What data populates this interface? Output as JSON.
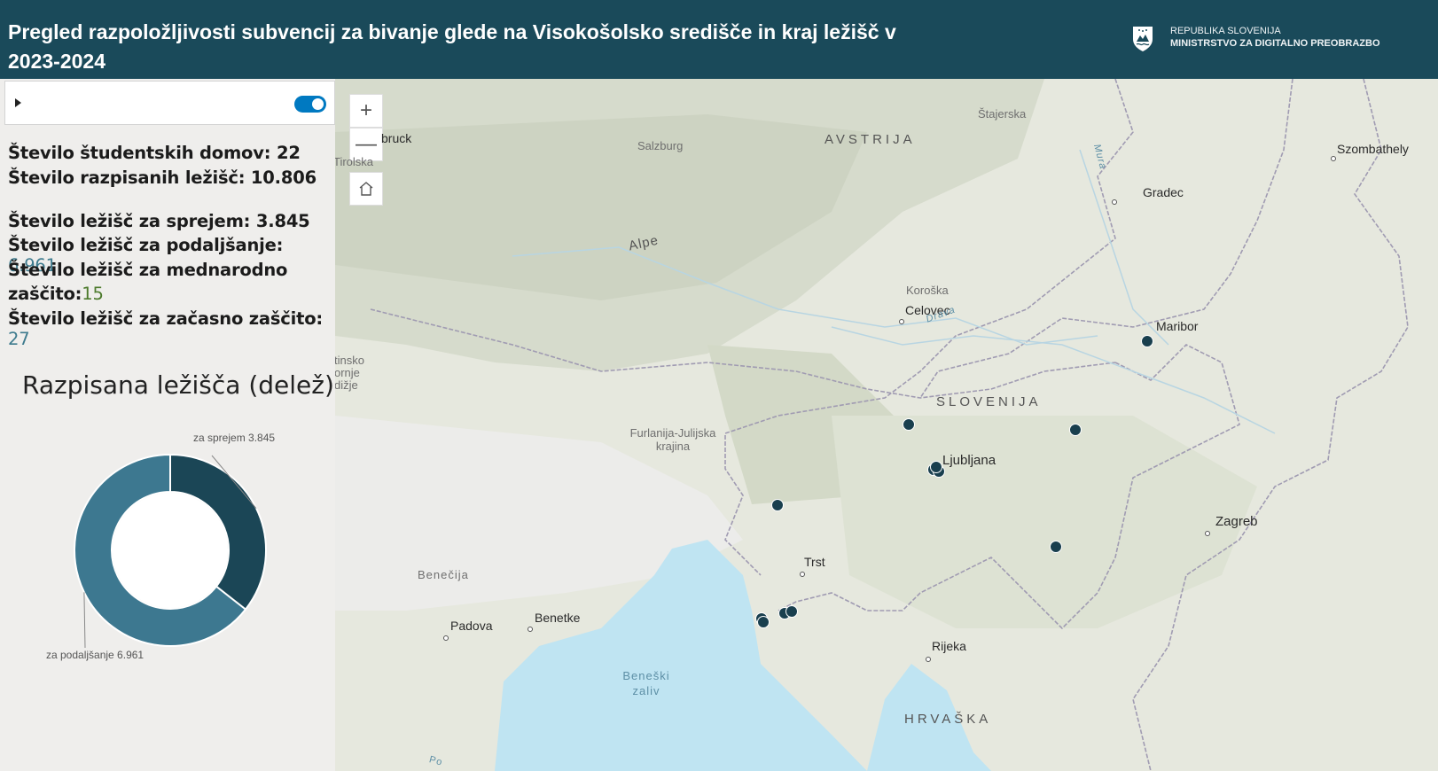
{
  "header": {
    "title": "Pregled razpoložljivosti subvencij za bivanje glede na Visokošolsko središče in kraj ležišč v 2023-2024",
    "logo_line1": "REPUBLIKA SLOVENIJA",
    "logo_line2": "MINISTRSTVO ZA DIGITALNO PREOBRAZBO"
  },
  "stats": {
    "domovi": "Število študentskih domov: 22",
    "razpisana": "Število razpisanih ležišč: 10.806",
    "sprejem": "Število ležišč za sprejem: 3.845",
    "podaljsanje_label": "Število ležišč za podaljšanje: ",
    "podaljsanje_value": "6.961",
    "mednarodno_line1": "Število ležišč za mednarodno",
    "mednarodno_line2": "zaščito:",
    "mednarodno_value": "15",
    "zacasno_label": "Število ležišč za začasno zaščito: ",
    "zacasno_value": "27"
  },
  "chart_data": {
    "type": "pie",
    "title": "Razpisana ležišča (delež)",
    "categories": [
      "za sprejem",
      "za podaljšanje"
    ],
    "values": [
      3845,
      6961
    ],
    "labels": [
      "za sprejem 3.845",
      "za podaljšanje 6.961"
    ],
    "colors": [
      "#1b4656",
      "#3d7890"
    ],
    "donut": true
  },
  "map": {
    "countries": [
      "AVSTRIJA",
      "SLOVENIJA",
      "HRVAŠKA"
    ],
    "cities": [
      "bruck",
      "Salzburg",
      "Szombathely",
      "Gradec",
      "Celovec",
      "Maribor",
      "Ljubljana",
      "Zagreb",
      "Trst",
      "Benetke",
      "Padova",
      "Rijeka"
    ],
    "regions": [
      "Štajerska",
      "Koroška",
      "Furlanija-Julijska krajina",
      "Benečija",
      "Alpe",
      "Tirolska",
      "tinsko",
      "ornje",
      "dižje"
    ],
    "water": [
      "Beneški zaliv",
      "Drava",
      "Mura",
      "Po"
    ],
    "controls": {
      "zoom_in": "+",
      "zoom_out": "—"
    }
  }
}
